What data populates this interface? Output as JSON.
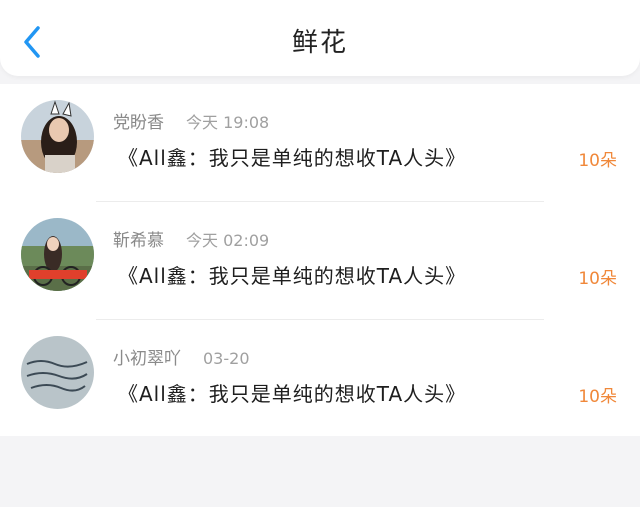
{
  "header": {
    "title": "鲜花",
    "back_icon": "chevron-left-icon",
    "accent_color": "#2196f3"
  },
  "items": [
    {
      "name": "党盼香",
      "time": "今天 19:08",
      "content": "《All鑫：我只是单纯的想收TA人头》",
      "count": "10朵"
    },
    {
      "name": "靳希慕",
      "time": "今天 02:09",
      "content": "《All鑫：我只是单纯的想收TA人头》",
      "count": "10朵"
    },
    {
      "name": "小初翠吖",
      "time": "03-20",
      "content": "《All鑫：我只是单纯的想收TA人头》",
      "count": "10朵"
    }
  ],
  "colors": {
    "count": "#f0883a",
    "name": "#8a8a8a"
  }
}
